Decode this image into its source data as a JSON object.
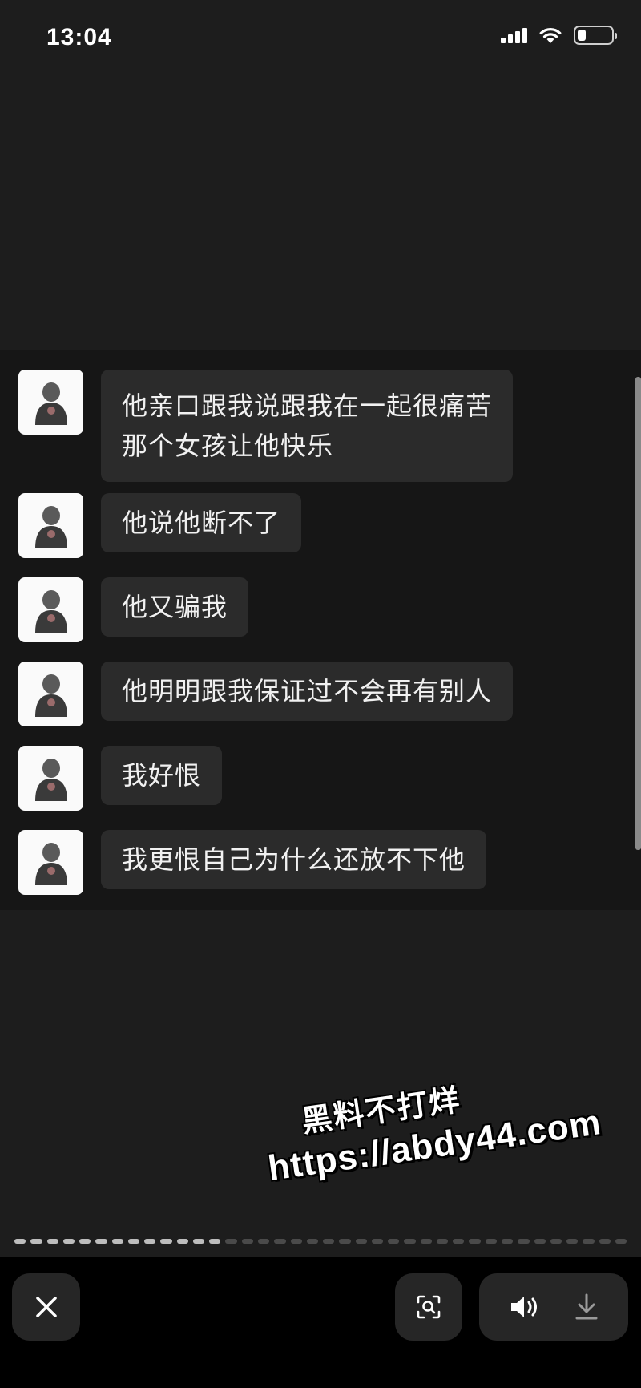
{
  "status_bar": {
    "time": "13:04",
    "icons": [
      "signal-icon",
      "wifi-icon",
      "battery-icon"
    ],
    "battery_level_percent": 25
  },
  "chat": {
    "messages": [
      {
        "lines": [
          "他亲口跟我说跟我在一起很痛苦",
          "那个女孩让他快乐"
        ]
      },
      {
        "lines": [
          "他说他断不了"
        ]
      },
      {
        "lines": [
          "他又骗我"
        ]
      },
      {
        "lines": [
          "他明明跟我保证过不会再有别人"
        ]
      },
      {
        "lines": [
          "我好恨"
        ]
      },
      {
        "lines": [
          "我更恨自己为什么还放不下他"
        ]
      }
    ]
  },
  "watermark": {
    "line1": "黑料不打烊",
    "line2": "https://abdy44.com"
  },
  "story_progress": {
    "total_segments": 38,
    "completed_segments": 13
  },
  "toolbar": {
    "icons": [
      "close-icon",
      "scan-icon",
      "speaker-icon",
      "download-icon"
    ]
  },
  "colors": {
    "background": "#1d1d1d",
    "chat_panel": "#161616",
    "bubble": "#2b2b2b",
    "bottom_bar": "#000000",
    "button": "#262626"
  }
}
